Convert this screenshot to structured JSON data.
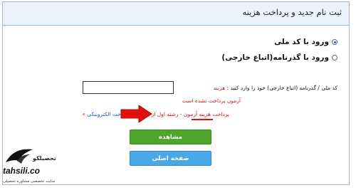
{
  "header": {
    "title": "ثبت نام جدید و پرداخت هزینه"
  },
  "options": [
    {
      "label": "ورود با کد ملی",
      "checked": true
    },
    {
      "label": "ورود با گذرنامه(اتباع خارجی)",
      "checked": false
    }
  ],
  "form": {
    "field_label": "کد ملی / گذرنامه (اتباع خارجی) خود را وارد کنید :",
    "required_mark": "هزینه",
    "input_value": ""
  },
  "messages": {
    "not_paid": "آزمون پرداخت نشده است",
    "payment_text": "پرداخت هزینه آزمون - رشته اول از یک گروه",
    "payment_link": "پرداخت الکترونیکی",
    "bullet": "»"
  },
  "buttons": {
    "view": "مشاهده",
    "home": "صفحه اصلی"
  },
  "logo": {
    "fa_name": "تحصیلکو",
    "domain": "tahsili.co",
    "subtitle": "سایت تخصصی مشاوره تحصیلی"
  },
  "colors": {
    "accent_red": "#d01515",
    "link_blue": "#1e55c8",
    "button_green": "#4ea62a",
    "button_blue": "#4aa8e6"
  }
}
